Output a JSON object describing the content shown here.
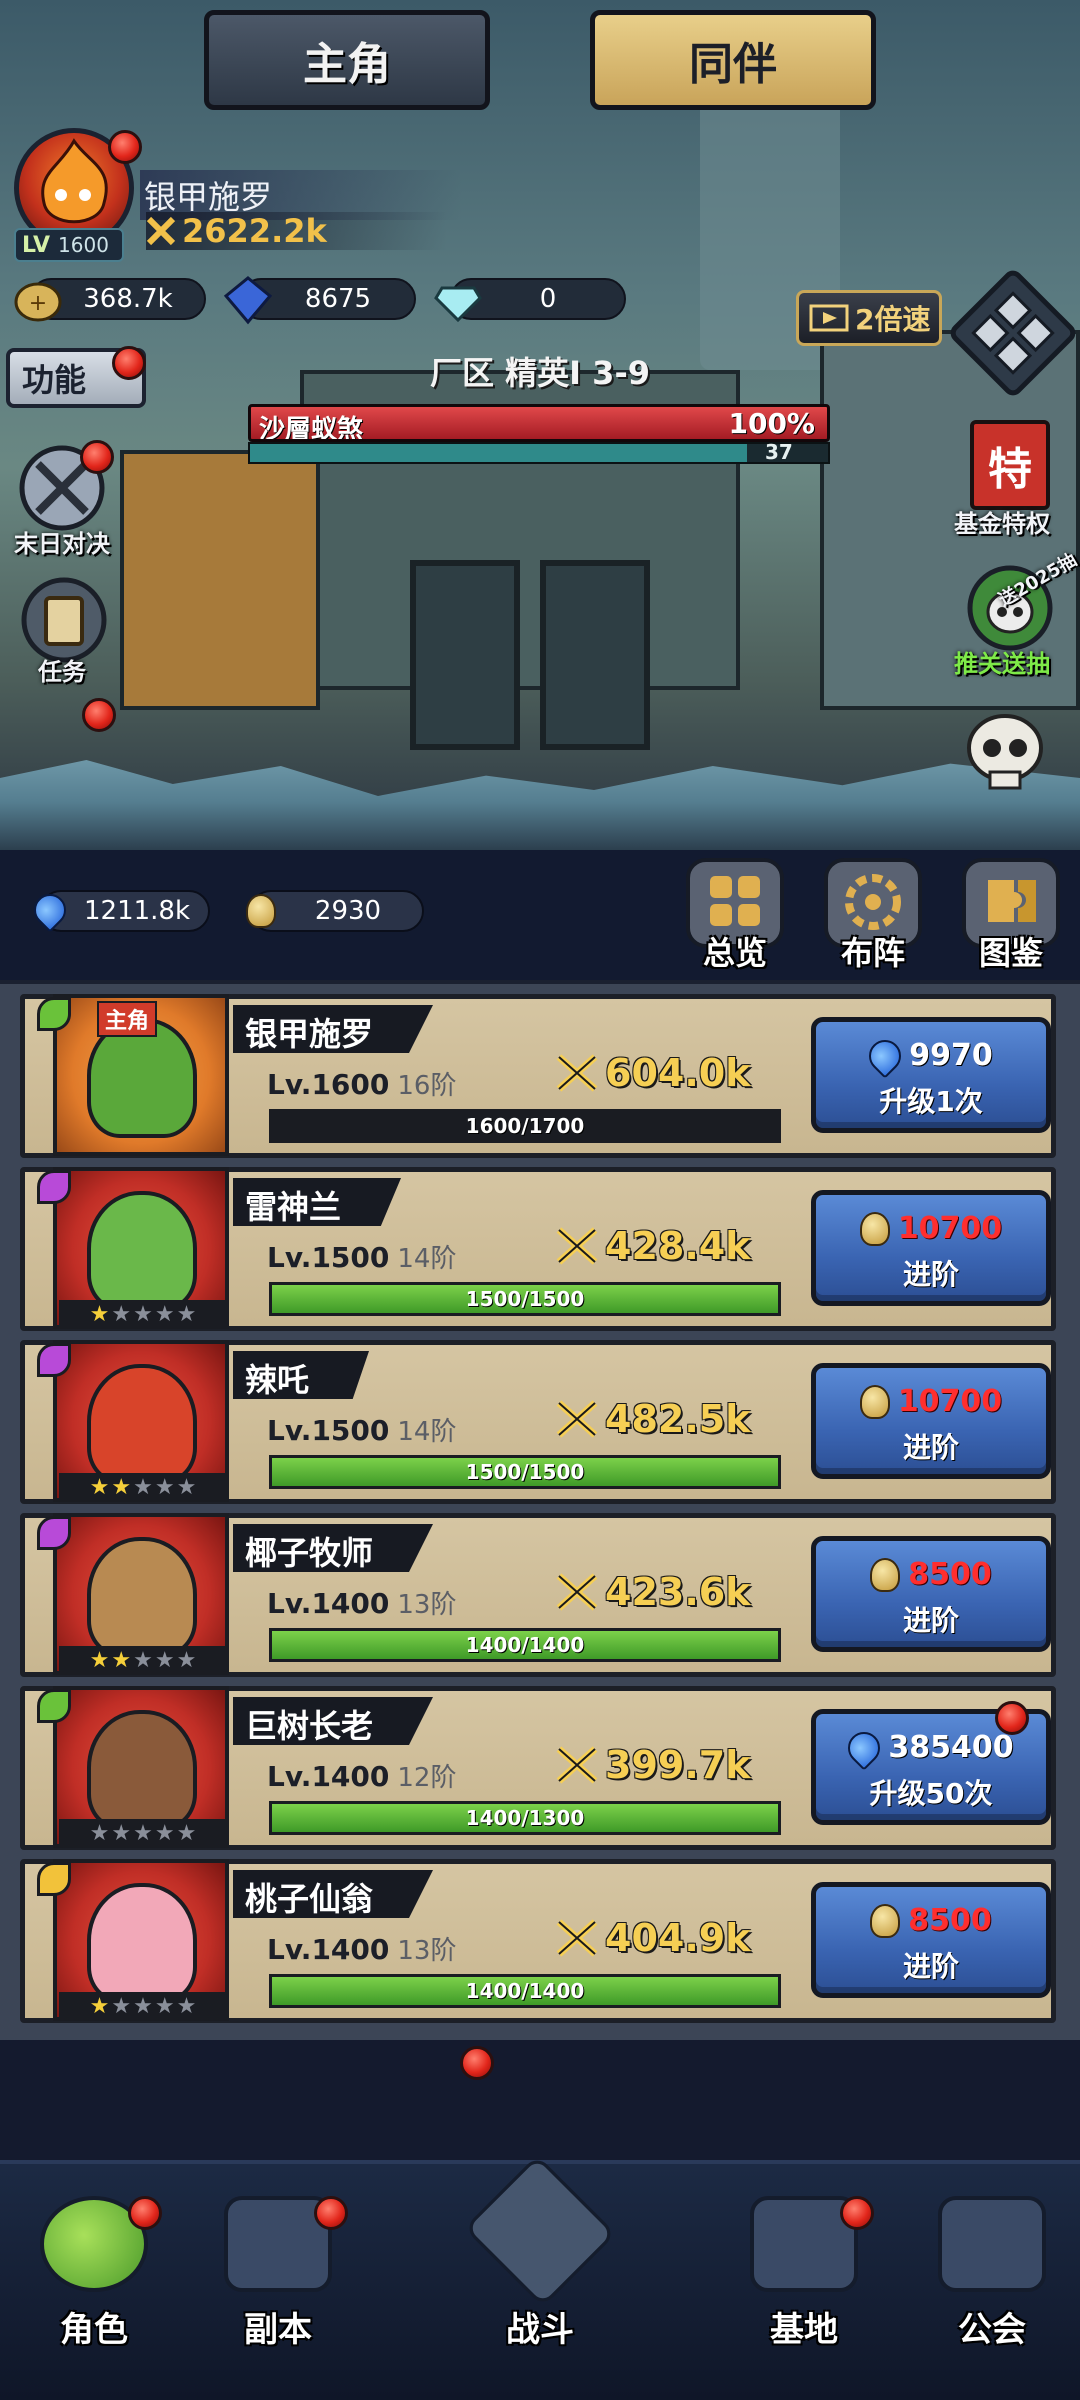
{
  "player": {
    "name": "银甲施罗",
    "level_prefix": "LV",
    "level": "1600",
    "power": "2622.2k"
  },
  "resources": {
    "gold": "368.7k",
    "gems": "8675",
    "diamonds": "0"
  },
  "left_menu": {
    "function_label": "功能",
    "doomsday": "末日对决",
    "tasks": "任务"
  },
  "right_menu": {
    "speed": "2倍速",
    "fund_privilege": "基金特权",
    "fund_glyph": "特",
    "pass_draw": "推关送抽",
    "pass_badge": "送2025抽"
  },
  "battle": {
    "stage": "厂区 精英I 3-9",
    "boss_name": "沙層蚁煞",
    "boss_hp_pct": "100%",
    "boss_hp_fraction": 1.0,
    "timer": "37",
    "timer_fraction": 0.86
  },
  "currencies": {
    "essence": "1211.8k",
    "seeds": "2930"
  },
  "menu": {
    "overview": "总览",
    "formation": "布阵",
    "codex": "图鉴"
  },
  "heroes": [
    {
      "name": "银甲施罗",
      "tag": "主角",
      "level": "Lv.1600",
      "stage": "16阶",
      "power": "604.0k",
      "xp": "1600/1700",
      "xp_fraction": 0.94,
      "xp_style": "dark",
      "cost": "9970",
      "cost_type": "essence",
      "cost_red": false,
      "action": "升级1次",
      "stars": 0,
      "star_total": 0,
      "bg": "orange",
      "body_color": "#5aa83a"
    },
    {
      "name": "雷神兰",
      "tag": "",
      "level": "Lv.1500",
      "stage": "14阶",
      "power": "428.4k",
      "xp": "1500/1500",
      "xp_fraction": 1.0,
      "xp_style": "green",
      "cost": "10700",
      "cost_type": "seed",
      "cost_red": true,
      "action": "进阶",
      "stars": 1,
      "star_total": 5,
      "bg": "red",
      "body_color": "#6ab84a"
    },
    {
      "name": "辣吒",
      "tag": "",
      "level": "Lv.1500",
      "stage": "14阶",
      "power": "482.5k",
      "xp": "1500/1500",
      "xp_fraction": 1.0,
      "xp_style": "green",
      "cost": "10700",
      "cost_type": "seed",
      "cost_red": true,
      "action": "进阶",
      "stars": 2,
      "star_total": 5,
      "bg": "red",
      "body_color": "#d8442a"
    },
    {
      "name": "椰子牧师",
      "tag": "",
      "level": "Lv.1400",
      "stage": "13阶",
      "power": "423.6k",
      "xp": "1400/1400",
      "xp_fraction": 1.0,
      "xp_style": "green",
      "cost": "8500",
      "cost_type": "seed",
      "cost_red": true,
      "action": "进阶",
      "stars": 2,
      "star_total": 5,
      "bg": "red",
      "body_color": "#b88a52"
    },
    {
      "name": "巨树长老",
      "tag": "",
      "level": "Lv.1400",
      "stage": "12阶",
      "power": "399.7k",
      "xp": "1400/1300",
      "xp_fraction": 1.0,
      "xp_style": "green",
      "cost": "385400",
      "cost_type": "essence",
      "cost_red": false,
      "action": "升级50次",
      "stars": 0,
      "star_total": 5,
      "bg": "red",
      "body_color": "#8a5a3a"
    },
    {
      "name": "桃子仙翁",
      "tag": "",
      "level": "Lv.1400",
      "stage": "13阶",
      "power": "404.9k",
      "xp": "1400/1400",
      "xp_fraction": 1.0,
      "xp_style": "green",
      "cost": "8500",
      "cost_type": "seed",
      "cost_red": true,
      "action": "进阶",
      "stars": 1,
      "star_total": 5,
      "bg": "red",
      "body_color": "#f2a8b8"
    }
  ],
  "tabs": {
    "hero": "主角",
    "partner": "同伴"
  },
  "nav": {
    "character": "角色",
    "dungeon": "副本",
    "battle": "战斗",
    "base": "基地",
    "guild": "公会"
  },
  "colors": {
    "accent_gold": "#f6cf54",
    "button_blue": "#3a64b2",
    "cost_red": "#ff2e2e",
    "xp_green": "#5cb83a"
  }
}
